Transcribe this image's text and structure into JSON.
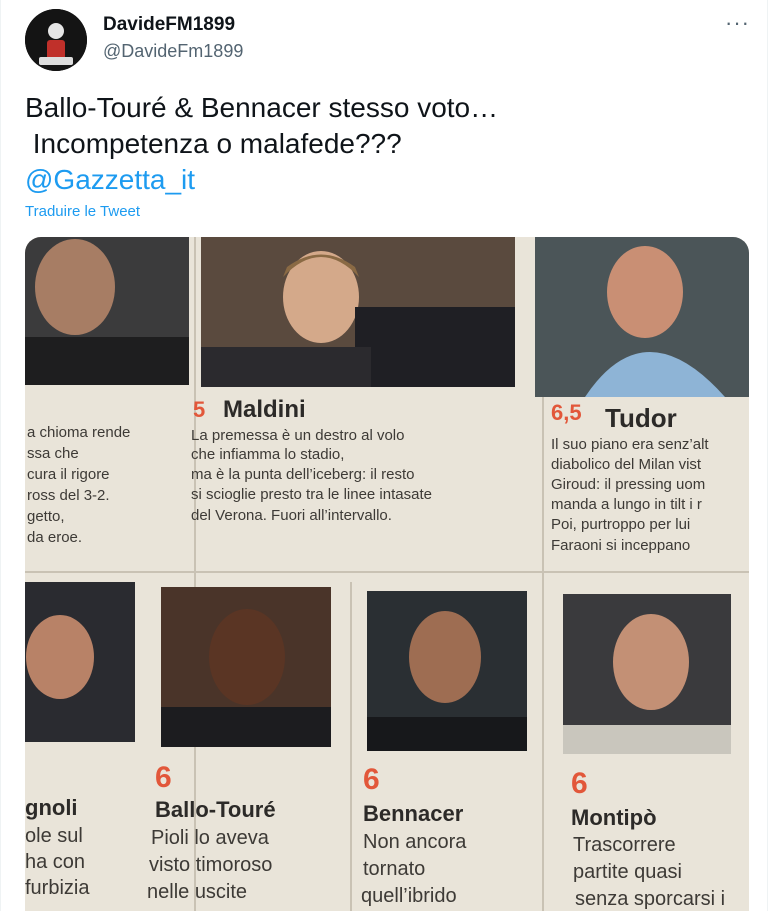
{
  "tweet": {
    "display_name": "DavideFM1899",
    "handle": "@DavideFm1899",
    "more_label": "···",
    "text_lines": [
      "Ballo-Touré & Bennacer stesso voto…",
      " Incompetenza o malafede???"
    ],
    "mention": "@Gazzetta_it",
    "translate_label": "Traduire le Tweet"
  },
  "image": {
    "left_cut": {
      "lines": [
        "a chioma rende",
        "ssa che",
        "cura il rigore",
        "ross del 3-2.",
        "getto,",
        "da eroe."
      ]
    },
    "maldini": {
      "grade": "5",
      "name": "Maldini",
      "lines": [
        "La premessa è un destro al volo",
        "che infiamma lo stadio,",
        "ma è la punta dell’iceberg: il resto",
        "si scioglie presto tra le linee intasate",
        "del Verona. Fuori all’intervallo."
      ]
    },
    "tudor": {
      "grade": "6,5",
      "name": "Tudor",
      "lines": [
        "Il suo piano era senz’alt",
        "diabolico del Milan vist",
        "Giroud: il pressing uom",
        "manda a lungo in tilt i r",
        "Poi, purtroppo per lui",
        "Faraoni si inceppano"
      ]
    },
    "bottom": [
      {
        "grade": "",
        "name": "gnoli",
        "lines": [
          "ole sul",
          "ha con",
          "furbizia"
        ]
      },
      {
        "grade": "6",
        "name": "Ballo-Touré",
        "lines": [
          "Pioli lo aveva",
          "visto timoroso",
          "nelle uscite"
        ]
      },
      {
        "grade": "6",
        "name": "Bennacer",
        "lines": [
          "Non ancora",
          "tornato",
          "quell’ibrido"
        ]
      },
      {
        "grade": "6",
        "name": "Montipò",
        "lines": [
          "Trascorrere",
          "partite quasi",
          "senza sporcarsi i"
        ]
      }
    ]
  },
  "colors": {
    "accent": "#1d9bf0",
    "grade": "#e2573a",
    "paper": "#e8e3d8"
  }
}
